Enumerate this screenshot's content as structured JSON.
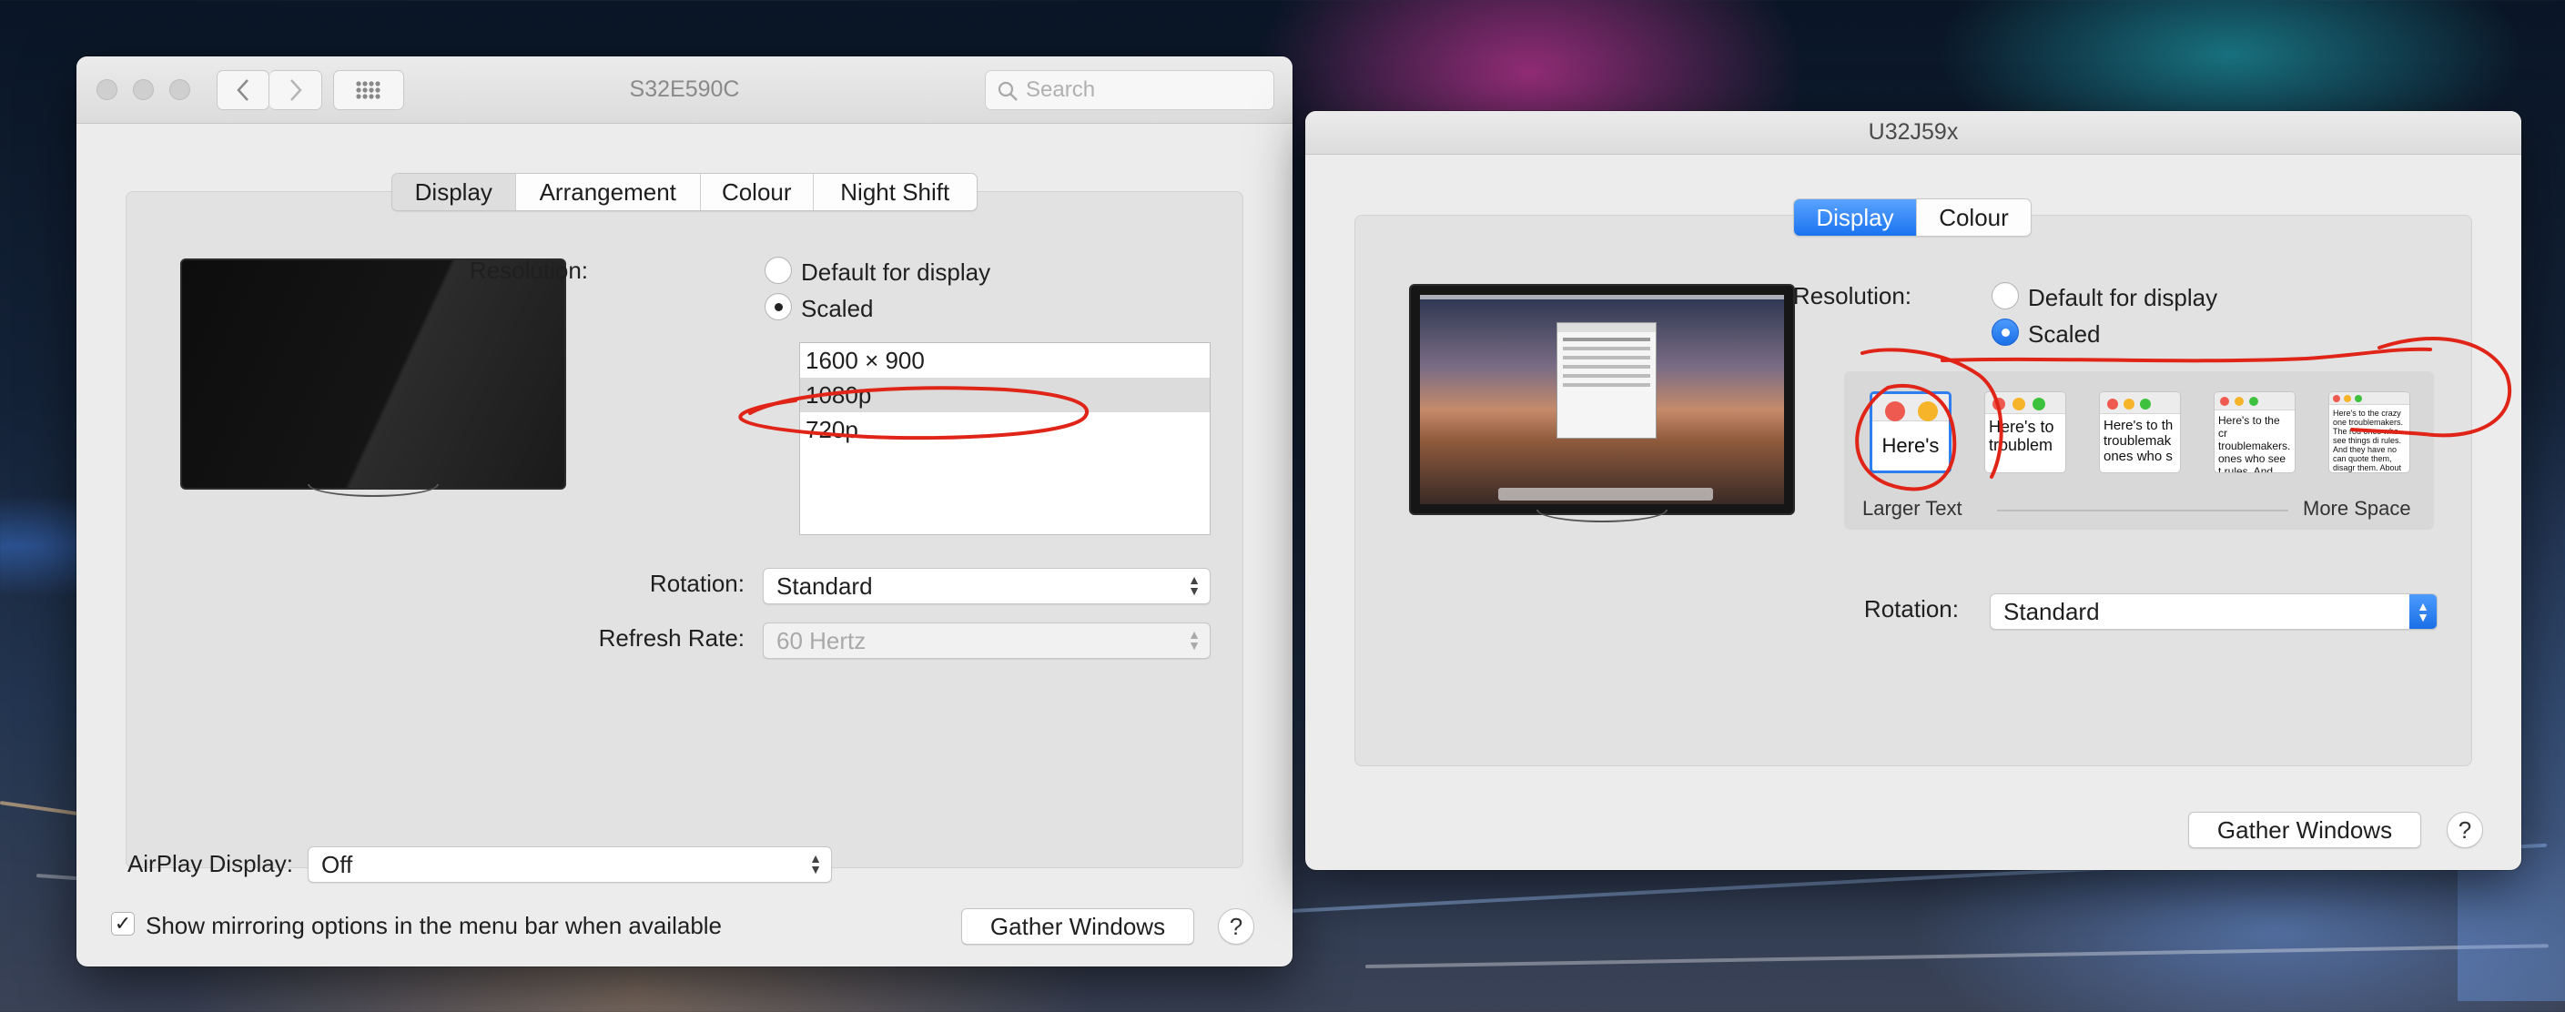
{
  "window_left": {
    "title": "S32E590C",
    "search_placeholder": "Search",
    "tabs": [
      "Display",
      "Arrangement",
      "Colour",
      "Night Shift"
    ],
    "resolution_label": "Resolution:",
    "radio_default": "Default for display",
    "radio_scaled": "Scaled",
    "resolutions": [
      "1600 × 900",
      "1080p",
      "720p"
    ],
    "selected_resolution": "1080p",
    "rotation_label": "Rotation:",
    "rotation_value": "Standard",
    "refresh_label": "Refresh Rate:",
    "refresh_value": "60 Hertz",
    "airplay_label": "AirPlay Display:",
    "airplay_value": "Off",
    "mirroring_checkbox_label": "Show mirroring options in the menu bar when available",
    "mirroring_checked": true,
    "gather_button": "Gather Windows",
    "help_button": "?"
  },
  "window_right": {
    "title": "U32J59x",
    "tabs": [
      "Display",
      "Colour"
    ],
    "resolution_label": "Resolution:",
    "radio_default": "Default for display",
    "radio_scaled": "Scaled",
    "scale_thumbs": [
      "Here's",
      "Here's to troublem",
      "Here's to th troublemak ones who s",
      "Here's to the cr troublemakers. ones who see t rules. And they",
      "Here's to the crazy one troublemakers. The rou ones who see things di rules. And they have no can quote them, disagr them. About the only th Because they change th"
    ],
    "selected_scale_index": 0,
    "scale_left_label": "Larger Text",
    "scale_right_label": "More Space",
    "rotation_label": "Rotation:",
    "rotation_value": "Standard",
    "gather_button": "Gather Windows",
    "help_button": "?"
  },
  "colors": {
    "accent_blue": "#1a73f0",
    "annotation_red": "#e02418",
    "traffic_red": "#ee5a50",
    "traffic_yellow": "#f6b42a",
    "traffic_green": "#3ec23e"
  },
  "icons": {
    "back": "chevron-left-icon",
    "forward": "chevron-right-icon",
    "grid": "grid-icon",
    "search": "search-icon",
    "popup_arrows": "updown-chevron-icon"
  }
}
